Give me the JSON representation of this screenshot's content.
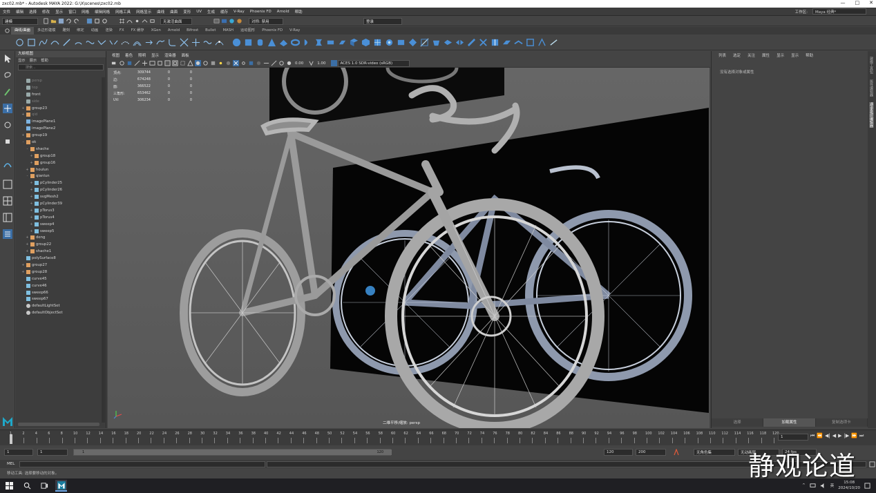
{
  "window": {
    "title": "zxc02.mb* - Autodesk MAYA 2022: G:\\X\\scenes\\zxc02.mb",
    "controls": [
      "—",
      "□",
      "✕"
    ]
  },
  "menubar": {
    "items": [
      "文件",
      "编辑",
      "选择",
      "修改",
      "显示",
      "窗口",
      "网格",
      "编辑网格",
      "网格工具",
      "网格显示",
      "曲线",
      "曲面",
      "变形",
      "UV",
      "生成",
      "缓存",
      "V-Ray",
      "Phoenix FD",
      "Arnold",
      "帮助"
    ],
    "workspace_label": "工作区:",
    "workspace_value": "Maya 经典*"
  },
  "statusline": {
    "mode_menu": "建模",
    "no_live_surface": "无激活曲面",
    "symmetry": "对称: 禁用",
    "login": "登录"
  },
  "shelf": {
    "tabs": [
      "曲线/曲面",
      "多边形建模",
      "雕刻",
      "绑定",
      "动画",
      "渲染",
      "FX",
      "FX 缓存",
      "XGen",
      "Arnold",
      "Bifrost",
      "Bullet",
      "MASH",
      "运动图形",
      "Phoenix FD",
      "V-Ray"
    ],
    "active_tab": 0
  },
  "outliner": {
    "title": "大纲视图",
    "menu": [
      "显示",
      "展示",
      "帮助"
    ],
    "search_placeholder": "搜索...",
    "items": [
      {
        "label": "persp",
        "indent": 1,
        "dim": true,
        "type": "cam"
      },
      {
        "label": "top",
        "indent": 1,
        "dim": true,
        "type": "cam"
      },
      {
        "label": "front",
        "indent": 1,
        "dim": false,
        "type": "cam"
      },
      {
        "label": "side",
        "indent": 1,
        "dim": true,
        "type": "cam"
      },
      {
        "label": "group23",
        "indent": 1,
        "dim": false,
        "type": "grp",
        "exp": "+"
      },
      {
        "label": "qid",
        "indent": 1,
        "dim": true,
        "type": "grp",
        "exp": "+"
      },
      {
        "label": "imagePlane1",
        "indent": 1,
        "dim": false,
        "type": "img"
      },
      {
        "label": "imagePlane2",
        "indent": 1,
        "dim": false,
        "type": "img"
      },
      {
        "label": "group19",
        "indent": 1,
        "dim": false,
        "type": "grp",
        "exp": "+"
      },
      {
        "label": "ok",
        "indent": 1,
        "dim": false,
        "type": "grp",
        "exp": "-"
      },
      {
        "label": "shache",
        "indent": 2,
        "dim": false,
        "type": "grp",
        "exp": "-"
      },
      {
        "label": "group18",
        "indent": 3,
        "dim": false,
        "type": "grp",
        "exp": "+"
      },
      {
        "label": "group16",
        "indent": 3,
        "dim": false,
        "type": "grp",
        "exp": "+"
      },
      {
        "label": "houlun",
        "indent": 2,
        "dim": false,
        "type": "grp",
        "exp": "+"
      },
      {
        "label": "qianlun",
        "indent": 2,
        "dim": false,
        "type": "grp",
        "exp": "-"
      },
      {
        "label": "pCylinder25",
        "indent": 3,
        "dim": false,
        "type": "mesh",
        "exp": "+"
      },
      {
        "label": "pCylinder26",
        "indent": 3,
        "dim": false,
        "type": "mesh",
        "exp": "+"
      },
      {
        "label": "svgMesh2",
        "indent": 3,
        "dim": false,
        "type": "mesh",
        "exp": "+"
      },
      {
        "label": "pCylinder39",
        "indent": 3,
        "dim": false,
        "type": "mesh",
        "exp": "+"
      },
      {
        "label": "pTorus3",
        "indent": 3,
        "dim": false,
        "type": "mesh",
        "exp": "+"
      },
      {
        "label": "pTorus4",
        "indent": 3,
        "dim": false,
        "type": "mesh",
        "exp": "+"
      },
      {
        "label": "sweep4",
        "indent": 3,
        "dim": false,
        "type": "mesh",
        "exp": "+"
      },
      {
        "label": "sweep5",
        "indent": 3,
        "dim": false,
        "type": "mesh",
        "exp": "+"
      },
      {
        "label": "deng",
        "indent": 2,
        "dim": false,
        "type": "grp",
        "exp": "+"
      },
      {
        "label": "group22",
        "indent": 2,
        "dim": false,
        "type": "grp",
        "exp": "+"
      },
      {
        "label": "shache1",
        "indent": 2,
        "dim": false,
        "type": "grp",
        "exp": "+"
      },
      {
        "label": "polySurface8",
        "indent": 1,
        "dim": false,
        "type": "mesh"
      },
      {
        "label": "group27",
        "indent": 1,
        "dim": false,
        "type": "grp",
        "exp": "+"
      },
      {
        "label": "group28",
        "indent": 1,
        "dim": false,
        "type": "grp",
        "exp": "+"
      },
      {
        "label": "curve45",
        "indent": 1,
        "dim": false,
        "type": "crv"
      },
      {
        "label": "curve46",
        "indent": 1,
        "dim": false,
        "type": "crv"
      },
      {
        "label": "sweep66",
        "indent": 1,
        "dim": false,
        "type": "mesh"
      },
      {
        "label": "sweep67",
        "indent": 1,
        "dim": false,
        "type": "mesh"
      },
      {
        "label": "defaultLightSet",
        "indent": 1,
        "dim": false,
        "type": "set"
      },
      {
        "label": "defaultObjectSet",
        "indent": 1,
        "dim": false,
        "type": "set"
      }
    ]
  },
  "viewport": {
    "menu": [
      "视图",
      "着色",
      "照明",
      "显示",
      "渲染器",
      "面板"
    ],
    "field_a": "0.00",
    "field_b": "1.00",
    "colorspace": "ACES 1.0 SDR-video (sRGB)",
    "hud": [
      {
        "label": "顶点:",
        "v": "309744",
        "s": "0",
        "t": "0"
      },
      {
        "label": "边:",
        "v": "674248",
        "s": "0",
        "t": "0"
      },
      {
        "label": "面:",
        "v": "366522",
        "s": "0",
        "t": "0"
      },
      {
        "label": "三角形:",
        "v": "653462",
        "s": "0",
        "t": "0"
      },
      {
        "label": "UV:",
        "v": "306234",
        "s": "0",
        "t": "0"
      }
    ],
    "camera_label": "二维平移/缩放: persp"
  },
  "rightpanel": {
    "tabs": [
      "列表",
      "选定",
      "关注",
      "属性",
      "显示",
      "显示",
      "帮助"
    ],
    "message": "没有选择对象或属性",
    "bottom_tabs": [
      "选择",
      "加载属性",
      "复制选项卡"
    ],
    "active_bottom": 1,
    "side_tabs": [
      "建模工具包",
      "属性编辑器",
      "通道盒/层编辑器"
    ]
  },
  "timeslider": {
    "ticks": [
      "1",
      "2",
      "4",
      "6",
      "8",
      "10",
      "12",
      "14",
      "16",
      "18",
      "20",
      "22",
      "24",
      "26",
      "28",
      "30",
      "32",
      "34",
      "36",
      "38",
      "40",
      "42",
      "44",
      "46",
      "48",
      "50",
      "52",
      "54",
      "56",
      "58",
      "60",
      "62",
      "64",
      "66",
      "68",
      "70",
      "72",
      "74",
      "76",
      "78",
      "80",
      "82",
      "84",
      "86",
      "88",
      "90",
      "92",
      "94",
      "96",
      "98",
      "100",
      "102",
      "104",
      "106",
      "108",
      "110",
      "112",
      "114",
      "116",
      "118",
      "120"
    ],
    "current_frame": "1",
    "playback": [
      "⏮",
      "⏪",
      "◀|",
      "◀",
      "▶",
      "|▶",
      "⏩",
      "⏭"
    ]
  },
  "rangeslider": {
    "start": "1",
    "inner_start": "1",
    "range_start_label": "1",
    "range_end_label": "120",
    "inner_end": "120",
    "end": "200",
    "char_set": "无角色集",
    "anim_layer": "无动画层",
    "fps": "24 fps"
  },
  "cmdline": {
    "label": "MEL"
  },
  "helpline": {
    "text": "移动工具: 选择要移动的对象。"
  },
  "taskbar": {
    "lang": "英",
    "time": "15:08",
    "date": "2024/10/20"
  },
  "watermark": "静观论道"
}
